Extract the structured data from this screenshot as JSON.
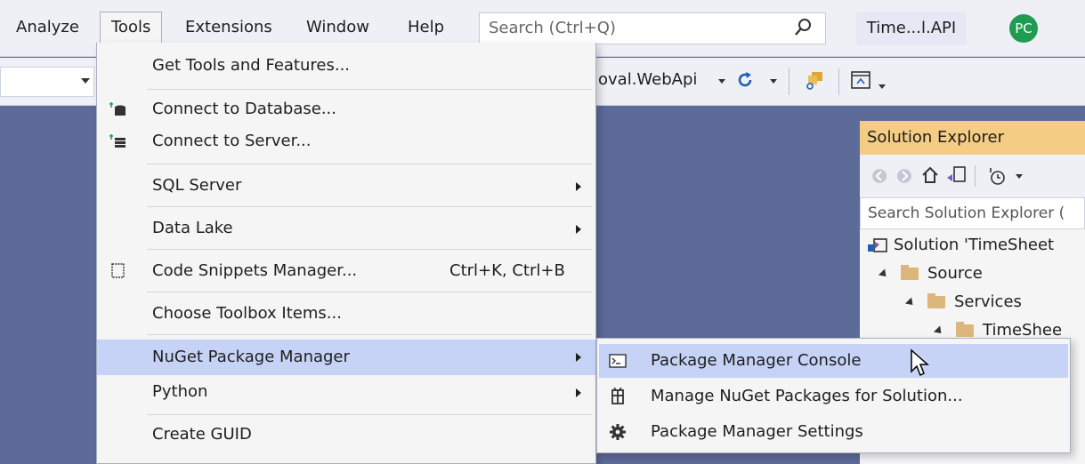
{
  "menubar": {
    "items": [
      "Analyze",
      "Tools",
      "Extensions",
      "Window",
      "Help"
    ],
    "search_placeholder": "Search (Ctrl+Q)",
    "project_badge": "Time...l.API",
    "avatar_initials": "PC"
  },
  "toolbar": {
    "startup_project": "oval.WebApi"
  },
  "tools_menu": {
    "items": [
      {
        "label": "Get Tools and Features..."
      },
      {
        "label": "Connect to Database...",
        "icon": "database-connect-icon"
      },
      {
        "label": "Connect to Server...",
        "icon": "server-connect-icon"
      },
      {
        "label": "SQL Server",
        "submenu": true
      },
      {
        "label": "Data Lake",
        "submenu": true
      },
      {
        "label": "Code Snippets Manager...",
        "shortcut": "Ctrl+K, Ctrl+B",
        "icon": "snippet-icon"
      },
      {
        "label": "Choose Toolbox Items..."
      },
      {
        "label": "NuGet Package Manager",
        "submenu": true,
        "highlighted": true
      },
      {
        "label": "Python",
        "submenu": true
      },
      {
        "label": "Create GUID"
      }
    ]
  },
  "nuget_submenu": {
    "items": [
      {
        "label": "Package Manager Console",
        "icon": "console-icon",
        "highlighted": true
      },
      {
        "label": "Manage NuGet Packages for Solution...",
        "icon": "nuget-package-icon"
      },
      {
        "label": "Package Manager Settings",
        "icon": "gear-icon"
      }
    ]
  },
  "solution_explorer": {
    "title": "Solution Explorer",
    "search_placeholder": "Search Solution Explorer (",
    "tree": [
      {
        "label": "Solution 'TimeSheet"
      },
      {
        "label": "Source"
      },
      {
        "label": "Services"
      },
      {
        "label": "TimeShee"
      }
    ]
  },
  "colors": {
    "background": "#5d6b99",
    "menu_bg": "#f5f5f5",
    "highlight": "#c6d3f6",
    "sol_title": "#f5cc84",
    "avatar": "#1f9c52"
  }
}
